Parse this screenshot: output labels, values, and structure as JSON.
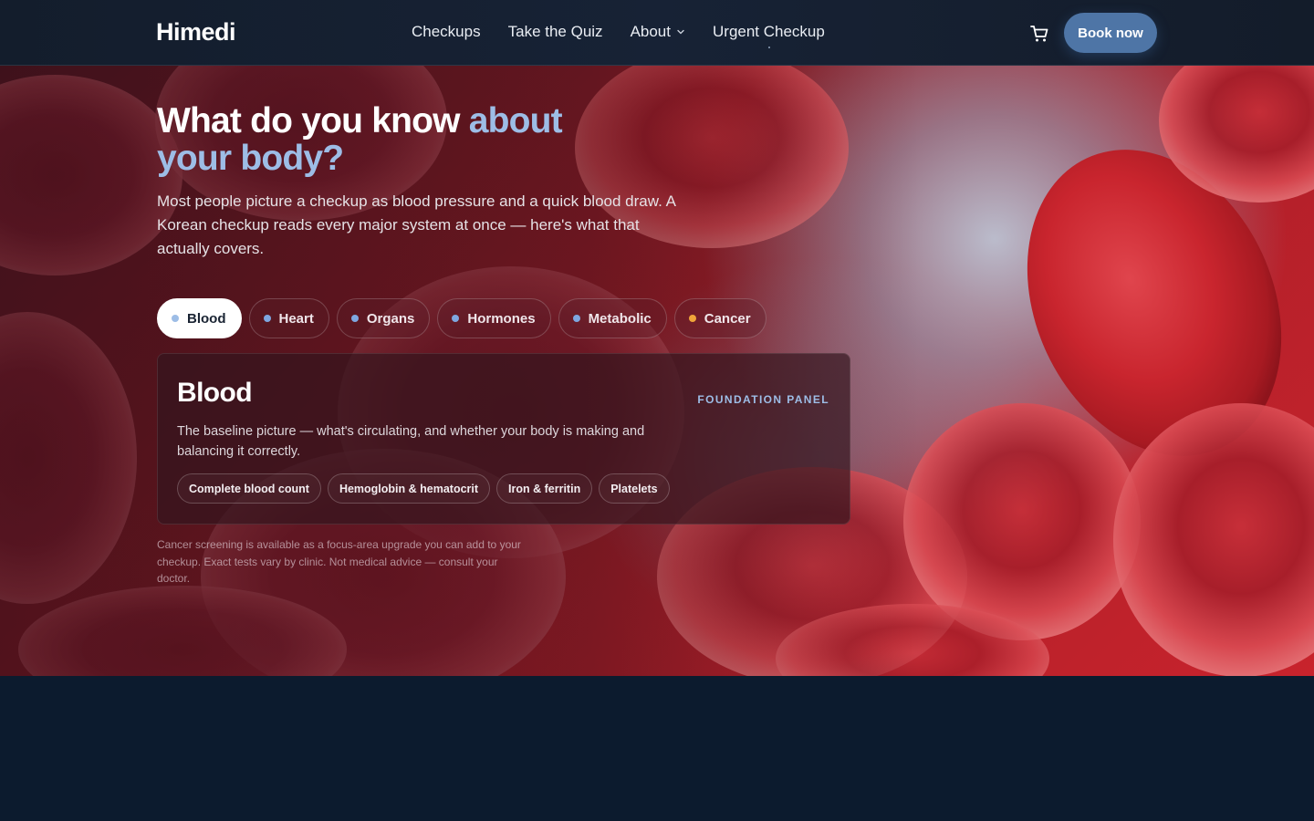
{
  "header": {
    "logo": "Himedi",
    "nav": [
      "Checkups",
      "Take the Quiz",
      "About",
      "Urgent Checkup"
    ],
    "book_label": "Book now"
  },
  "hero": {
    "headline_main": "What do you know ",
    "headline_accent": "about your body?",
    "lede": "Most people picture a checkup as blood pressure and a quick blood draw. A Korean checkup reads every major system at once — here's what that actually covers.",
    "tabs": [
      {
        "label": "Blood",
        "dot_color": "#9dbde6"
      },
      {
        "label": "Heart",
        "dot_color": "#7ea7e0"
      },
      {
        "label": "Organs",
        "dot_color": "#7ea7e0"
      },
      {
        "label": "Hormones",
        "dot_color": "#7ea7e0"
      },
      {
        "label": "Metabolic",
        "dot_color": "#7ea7e0"
      },
      {
        "label": "Cancer",
        "dot_color": "#f0a53a"
      }
    ],
    "active_tab": "Blood",
    "panel": {
      "title": "Blood",
      "tag": "FOUNDATION PANEL",
      "description": "The baseline picture — what's circulating, and whether your body is making and balancing it correctly.",
      "tests": [
        "Complete blood count",
        "Hemoglobin & hematocrit",
        "Iron & ferritin",
        "Platelets"
      ]
    },
    "footnote": "Cancer screening is available as a focus-area upgrade you can add to your checkup. Exact tests vary by clinic. Not medical advice — consult your doctor."
  },
  "icons": {
    "cart": "shopping-cart-icon",
    "chevron": "chevron-down-icon"
  },
  "colors": {
    "accent": "#9dbde6",
    "button": "#4e75a6",
    "page_background": "#0c1b2e",
    "cancer_dot": "#f0a53a"
  }
}
